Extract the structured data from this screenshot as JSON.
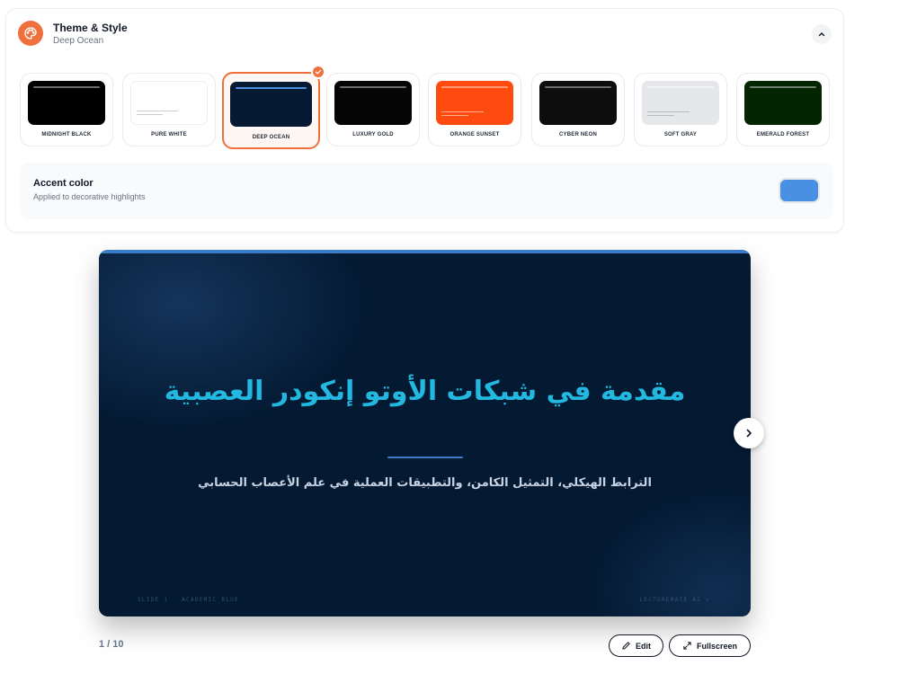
{
  "theme_panel": {
    "title": "Theme & Style",
    "subtitle": "Deep Ocean",
    "icon": "palette-icon",
    "collapse_icon": "chevron-up-icon",
    "accent_orange": "#f0703d",
    "themes": [
      {
        "name": "MIDNIGHT BLACK",
        "bg": "#000000",
        "bar": "#6b6b6b",
        "selected": false
      },
      {
        "name": "PURE WHITE",
        "bg": "#ffffff",
        "bar": "#ffffff",
        "line": "#c9ccd1",
        "selected": false
      },
      {
        "name": "DEEP OCEAN",
        "bg": "#061a33",
        "bar": "#4a90e2",
        "selected": true
      },
      {
        "name": "LUXURY GOLD",
        "bg": "#050505",
        "bar": "#6b6b6b",
        "selected": false
      },
      {
        "name": "ORANGE SUNSET",
        "bg": "#ff4a10",
        "bar": "#ff9a70",
        "line": "#ffb08a",
        "selected": false
      },
      {
        "name": "CYBER NEON",
        "bg": "#0d0d0d",
        "bar": "#6b6b6b",
        "selected": false
      },
      {
        "name": "SOFT GRAY",
        "bg": "#e5e7eb",
        "bar": "#f3f4f6",
        "line": "#b6bbc2",
        "selected": false
      },
      {
        "name": "EMERALD FOREST",
        "bg": "#032600",
        "bar": "#6b7d6b",
        "selected": false
      }
    ],
    "accent": {
      "title": "Accent color",
      "subtitle": "Applied to decorative highlights",
      "color": "#4a90e2"
    }
  },
  "slide": {
    "title": "مقدمة في شبكات الأوتو إنكودر العصبية",
    "subtitle": "الترابط الهيكلي، التمثيل الكامن، والتطبيقات العملية في علم الأعصاب الحسابي",
    "footer_left": "SLIDE 1 · ACADEMIC_BLUE",
    "footer_right": "LECTUREMATE AI ✦",
    "background": "#041a33",
    "title_color": "#22b8e0"
  },
  "controls": {
    "page_counter": "1 / 10",
    "edit_label": "Edit",
    "fullscreen_label": "Fullscreen",
    "next_icon": "chevron-right-icon"
  }
}
